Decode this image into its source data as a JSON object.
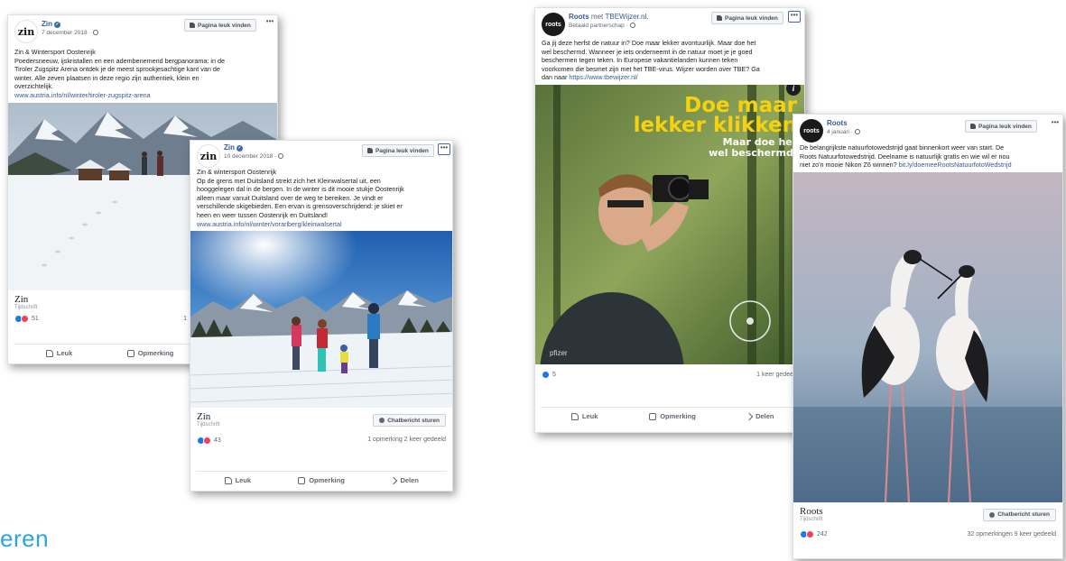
{
  "posts": {
    "zin1": {
      "page_name": "Zin",
      "date": "7 december 2018 ·",
      "like_page": "Pagina leuk vinden",
      "more": "•••",
      "avatar_text": "zin",
      "text_lines": [
        "Zin & Wintersport Oostenrijk",
        "Poedersneeuw, ijskristallen en een adembenemend bergpanorama: in de",
        "Tiroler Zugspitz Arena ontdek je de meest sprookjesachtige kant van de",
        "winter. Alle zeven plaatsen in deze regio zijn authentiek, klein en",
        "overzichtelijk."
      ],
      "link": "www.austria.info/nl/winter/tiroler-zugspitz-arena",
      "footer_title": "Zin",
      "footer_sub": "Tijdschrift",
      "react_count": "51",
      "stats_right": "1",
      "actions": [
        "Leuk",
        "Opmerking"
      ]
    },
    "zin2": {
      "page_name": "Zin",
      "date": "10 december 2018 ·",
      "like_page": "Pagina leuk vinden",
      "more": "•••",
      "avatar_text": "zin",
      "text_lines": [
        "Zin & wintersport Oostenrijk",
        "Op de grens met Duitsland strekt zich het Kleinwalsertal uit, een",
        "hooggelegen dal in de bergen. In de winter is dit mooie stukje Oostenrijk",
        "alleen maar vanuit Duitsland over de weg te bereiken. Je vindt er",
        "verschillende skigebieden. Een ervan is grensoverschrijdend: je skiet er",
        "heen en weer tussen Oostenrijk en Duitsland!"
      ],
      "link": "www.austria.info/nl/winter/vorarlberg/kleinwalsertal",
      "footer_title": "Zin",
      "footer_sub": "Tijdschrift",
      "chat_button": "Chatbericht sturen",
      "react_count": "43",
      "stats_right": "1 opmerking  2 keer gedeeld",
      "actions": [
        "Leuk",
        "Opmerking",
        "Delen"
      ]
    },
    "roots1": {
      "page_name": "Roots",
      "with_text": "met",
      "partner": "TBEWijzer.nl.",
      "date": "Betaald partnerschap ·",
      "like_page": "Pagina leuk vinden",
      "more": "•••",
      "avatar_text": "roots",
      "text_lines": [
        "Ga jij deze herfst de natuur in? Doe maar lekker avontuurlijk. Maar doe het",
        "wel beschermd. Wanneer je iets onderneemt in de natuur moet je je goed",
        "beschermen tegen teken. In Europese vakantielanden kunnen teken",
        "voorkomen die besmet zijn met het TBE-virus. Wijzer worden over TBE? Ga",
        "dan naar"
      ],
      "link": "https://www.tbewijzer.nl/",
      "ad_headline_1": "Doe maar",
      "ad_headline_2": "lekker klikken",
      "ad_sub_1": "Maar doe het",
      "ad_sub_2": "wel beschermd.",
      "info": "i",
      "react_count": "5",
      "stats_right": "1 keer gedee",
      "actions": [
        "Leuk",
        "Opmerking",
        "Delen"
      ]
    },
    "roots2": {
      "page_name": "Roots",
      "date": "4 januari ·",
      "like_page": "Pagina leuk vinden",
      "more": "•••",
      "avatar_text": "roots",
      "text_lines": [
        "De belangrijkste natuurfotowedstrijd gaat binnenkort weer van start. De",
        "Roots Natuurfotowedstrijd. Deelname is natuurlijk gratis en wie wil er nou",
        "niet zo'n mooie Nikon Z6 winnen?"
      ],
      "link": "bit.ly/doemeeRootsNatuurfotoWedstrijd",
      "footer_title": "Roots",
      "footer_sub": "Tijdschrift",
      "chat_button": "Chatbericht sturen",
      "react_count": "242",
      "stats_right": "32 opmerkingen  9 keer gedeeld"
    }
  },
  "bottom_word": "eren",
  "colors": {
    "facebook_link": "#385898",
    "accent_cyan": "#2aa6de",
    "ad_yellow": "#f5d10f"
  }
}
